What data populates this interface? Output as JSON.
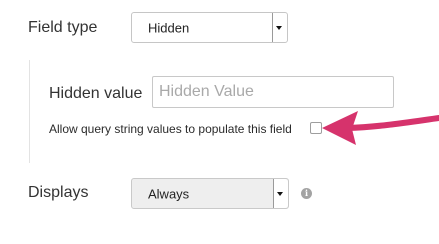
{
  "form": {
    "field_type": {
      "label": "Field type",
      "selected": "Hidden"
    },
    "hidden_value": {
      "label": "Hidden value",
      "value": "",
      "placeholder": "Hidden Value"
    },
    "query_string": {
      "label": "Allow query string values to populate this field",
      "checked": false
    },
    "displays": {
      "label": "Displays",
      "selected": "Always",
      "info_icon_glyph": "i"
    }
  },
  "annotation": {
    "arrow_color": "#d6336c",
    "icon": "pointer-arrow-icon"
  },
  "colors": {
    "input_border": "#c8c8c8",
    "placeholder": "#a9a9a9",
    "info_icon": "#a3a3a3"
  }
}
